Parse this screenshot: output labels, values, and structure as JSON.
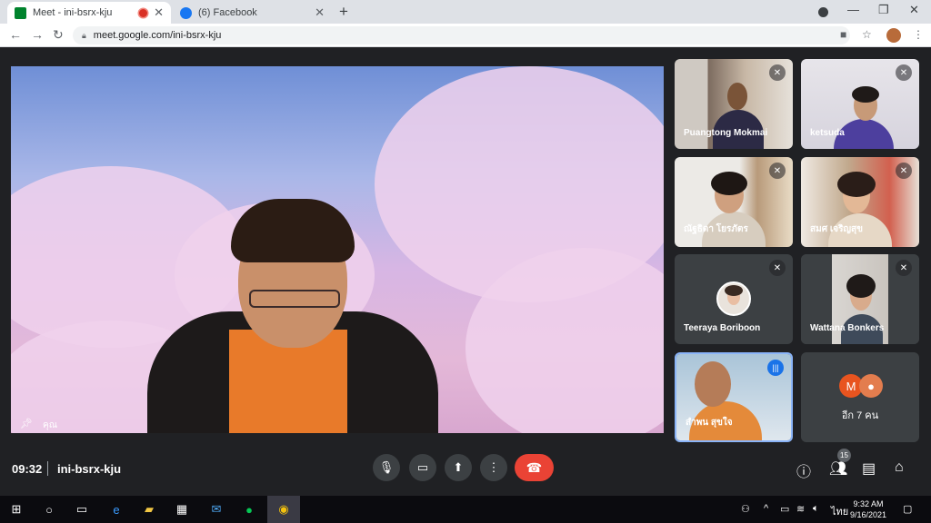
{
  "browser": {
    "tabs": [
      {
        "label": "Meet - ini-bsrx-kju",
        "close": "✕",
        "recording": true
      },
      {
        "label": "(6) Facebook",
        "close": "✕"
      }
    ],
    "new_tab": "+",
    "url": "meet.google.com/ini-bsrx-kju",
    "window_controls": {
      "minimize": "—",
      "maximize": "❐",
      "close": "✕"
    }
  },
  "meet": {
    "main_speaker_name": "คุณ",
    "participants": [
      {
        "name": "Puangtong Mokmai",
        "muted": true
      },
      {
        "name": "ketsuda",
        "muted": true
      },
      {
        "name": "ณัฐธิดา โยรภัตร",
        "muted": true
      },
      {
        "name": "สมศ เจริญสุข",
        "muted": true
      },
      {
        "name": "Teeraya Boriboon",
        "muted": true
      },
      {
        "name": "Wattana Bonkers",
        "muted": true
      },
      {
        "name": "สำพน สุขใจ",
        "speaking": true
      }
    ],
    "more_tile": {
      "avatar_letter": "M",
      "label": "อีก 7 คน"
    },
    "time": "09:32",
    "meeting_code": "ini-bsrx-kju",
    "people_count": "15"
  },
  "colors": {
    "end_call": "#ea4335",
    "control_bg": "#3c4043",
    "accent": "#1a73e8",
    "m_avatar": "#e8541f"
  },
  "taskbar": {
    "clock_time": "9:32 AM",
    "clock_date": "9/16/2021",
    "language": "ไทย"
  }
}
